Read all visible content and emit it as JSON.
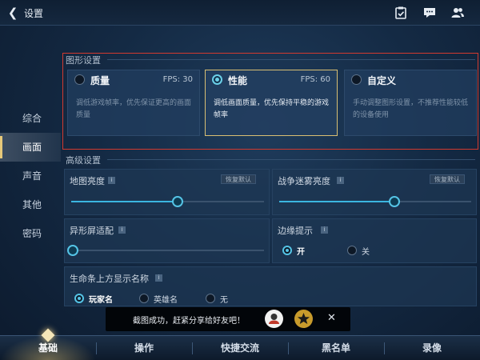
{
  "header": {
    "title": "设置"
  },
  "sidebar": {
    "items": [
      "综合",
      "画面",
      "声音",
      "其他",
      "密码"
    ],
    "active_index": 1
  },
  "graphics": {
    "section_title": "图形设置",
    "cards": [
      {
        "name": "质量",
        "fps": "FPS: 30",
        "desc": "调低游戏帧率，优先保证更高的画面质量"
      },
      {
        "name": "性能",
        "fps": "FPS: 60",
        "desc": "调低画面质量，优先保持平稳的游戏帧率"
      },
      {
        "name": "自定义",
        "fps": "",
        "desc": "手动调整图形设置，不推荐性能较低的设备使用"
      }
    ],
    "selected_index": 1
  },
  "advanced": {
    "section_title": "高级设置",
    "map_brightness": {
      "label": "地图亮度",
      "reset": "恢复默认",
      "value": 0.55
    },
    "fog_brightness": {
      "label": "战争迷雾亮度",
      "reset": "恢复默认",
      "value": 0.6
    },
    "notch": {
      "label": "异形屏适配",
      "value": 0.0
    },
    "edge_hint": {
      "label": "边缘提示",
      "options": [
        "开",
        "关"
      ],
      "selected": 0
    },
    "health_bar_name": {
      "label": "生命条上方显示名称",
      "options": [
        "玩家名",
        "英雄名",
        "无"
      ],
      "selected": 0
    },
    "info_mark": "i"
  },
  "toast": {
    "text": "截图成功，赶紧分享给好友吧！",
    "close": "✕"
  },
  "bottom_nav": {
    "tabs": [
      "基础",
      "操作",
      "快捷交流",
      "黑名单",
      "录像"
    ],
    "active_index": 0
  },
  "icons": {
    "back": "back-arrow-icon",
    "clipboard": "clipboard-check-icon",
    "chat": "chat-bubble-icon",
    "friends": "friends-icon",
    "share_player": "player-avatar-icon",
    "share_star": "star-icon"
  },
  "colors": {
    "accent_gold": "#e7c97a",
    "accent_cyan": "#55c4e6",
    "highlight_red": "#d23a2f"
  }
}
